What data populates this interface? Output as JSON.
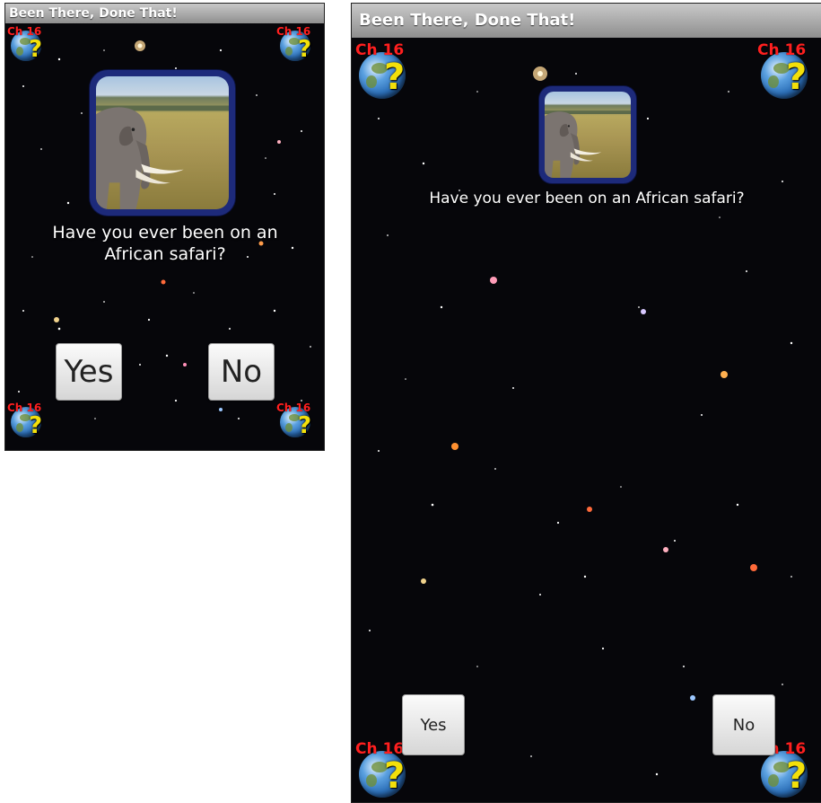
{
  "app": {
    "title": "Been There, Done That!",
    "corner_label": "Ch 16",
    "corner_mark": "?"
  },
  "prompt": {
    "question": "Have you ever been on an African safari?",
    "image": "elephant-on-savanna"
  },
  "buttons": {
    "yes_label": "Yes",
    "no_label": "No"
  },
  "colors": {
    "titlebar": "#9e9e9e",
    "background": "#06060a",
    "frame": "#1d2a7a",
    "corner_label": "#ff1f1f",
    "question_mark": "#f3e00a"
  }
}
